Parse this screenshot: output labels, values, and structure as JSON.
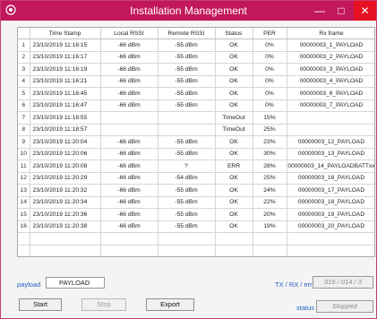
{
  "window": {
    "title": "Installation Management"
  },
  "table": {
    "headers": [
      "",
      "Time Stamp",
      "Local RSSI",
      "Remote RSSI",
      "Status",
      "PER",
      "Rx frame"
    ],
    "rows": [
      [
        "1",
        "23/10/2019 11:16:15",
        "-66 dBm",
        "-55 dBm",
        "OK",
        "0%",
        "00000003_1_PAYLOAD"
      ],
      [
        "2",
        "23/10/2019 11:16:17",
        "-66 dBm",
        "-55 dBm",
        "OK",
        "0%",
        "00000003_2_PAYLOAD"
      ],
      [
        "3",
        "23/10/2019 11:16:19",
        "-66 dBm",
        "-55 dBm",
        "OK",
        "0%",
        "00000003_3_PAYLOAD"
      ],
      [
        "4",
        "23/10/2019 11:16:21",
        "-66 dBm",
        "-55 dBm",
        "OK",
        "0%",
        "00000003_4_PAYLOAD"
      ],
      [
        "5",
        "23/10/2019 11:16:45",
        "-66 dBm",
        "-55 dBm",
        "OK",
        "0%",
        "00000003_6_PAYLOAD"
      ],
      [
        "6",
        "23/10/2019 11:16:47",
        "-66 dBm",
        "-55 dBm",
        "OK",
        "0%",
        "00000003_7_PAYLOAD"
      ],
      [
        "7",
        "23/10/2019 11:18:55",
        "",
        "",
        "TimeOut",
        "15%",
        ""
      ],
      [
        "8",
        "23/10/2019 11:18:57",
        "",
        "",
        "TimeOut",
        "25%",
        ""
      ],
      [
        "9",
        "23/10/2019 11:20:04",
        "-66 dBm",
        "-55 dBm",
        "OK",
        "23%",
        "00000003_12_PAYLOAD"
      ],
      [
        "10",
        "23/10/2019 11:20:06",
        "-66 dBm",
        "-55 dBm",
        "OK",
        "30%",
        "00000003_13_PAYLOAD"
      ],
      [
        "11",
        "23/10/2019 11:20:08",
        "-66 dBm",
        "?",
        "ERR",
        "28%",
        "00000003_14_PAYLOADBATTxx"
      ],
      [
        "12",
        "23/10/2019 11:20:29",
        "-66 dBm",
        "-54 dBm",
        "OK",
        "25%",
        "00000003_16_PAYLOAD"
      ],
      [
        "13",
        "23/10/2019 11:20:32",
        "-66 dBm",
        "-55 dBm",
        "OK",
        "24%",
        "00000003_17_PAYLOAD"
      ],
      [
        "14",
        "23/10/2019 11:20:34",
        "-66 dBm",
        "-55 dBm",
        "OK",
        "22%",
        "00000003_18_PAYLOAD"
      ],
      [
        "15",
        "23/10/2019 11:20:36",
        "-66 dBm",
        "-55 dBm",
        "OK",
        "20%",
        "00000003_19_PAYLOAD"
      ],
      [
        "16",
        "23/10/2019 11:20:38",
        "-66 dBm",
        "-55 dBm",
        "OK",
        "19%",
        "00000003_20_PAYLOAD"
      ],
      [
        "",
        "",
        "",
        "",
        "",
        "",
        ""
      ],
      [
        "",
        "",
        "",
        "",
        "",
        "",
        ""
      ],
      [
        "",
        "",
        "",
        "",
        "",
        "",
        ""
      ]
    ]
  },
  "payload": {
    "label": "payload",
    "value": "PAYLOAD"
  },
  "counters": {
    "label": "TX / RX / err",
    "value": "016 / 014 / 3"
  },
  "status": {
    "label": "status",
    "value": "Stopped"
  },
  "buttons": {
    "start": "Start",
    "stop": "Stop",
    "export": "Export"
  },
  "colors": {
    "titlebar": "#c2185b",
    "close": "#e81123",
    "label_text": "#1f5fbf"
  }
}
